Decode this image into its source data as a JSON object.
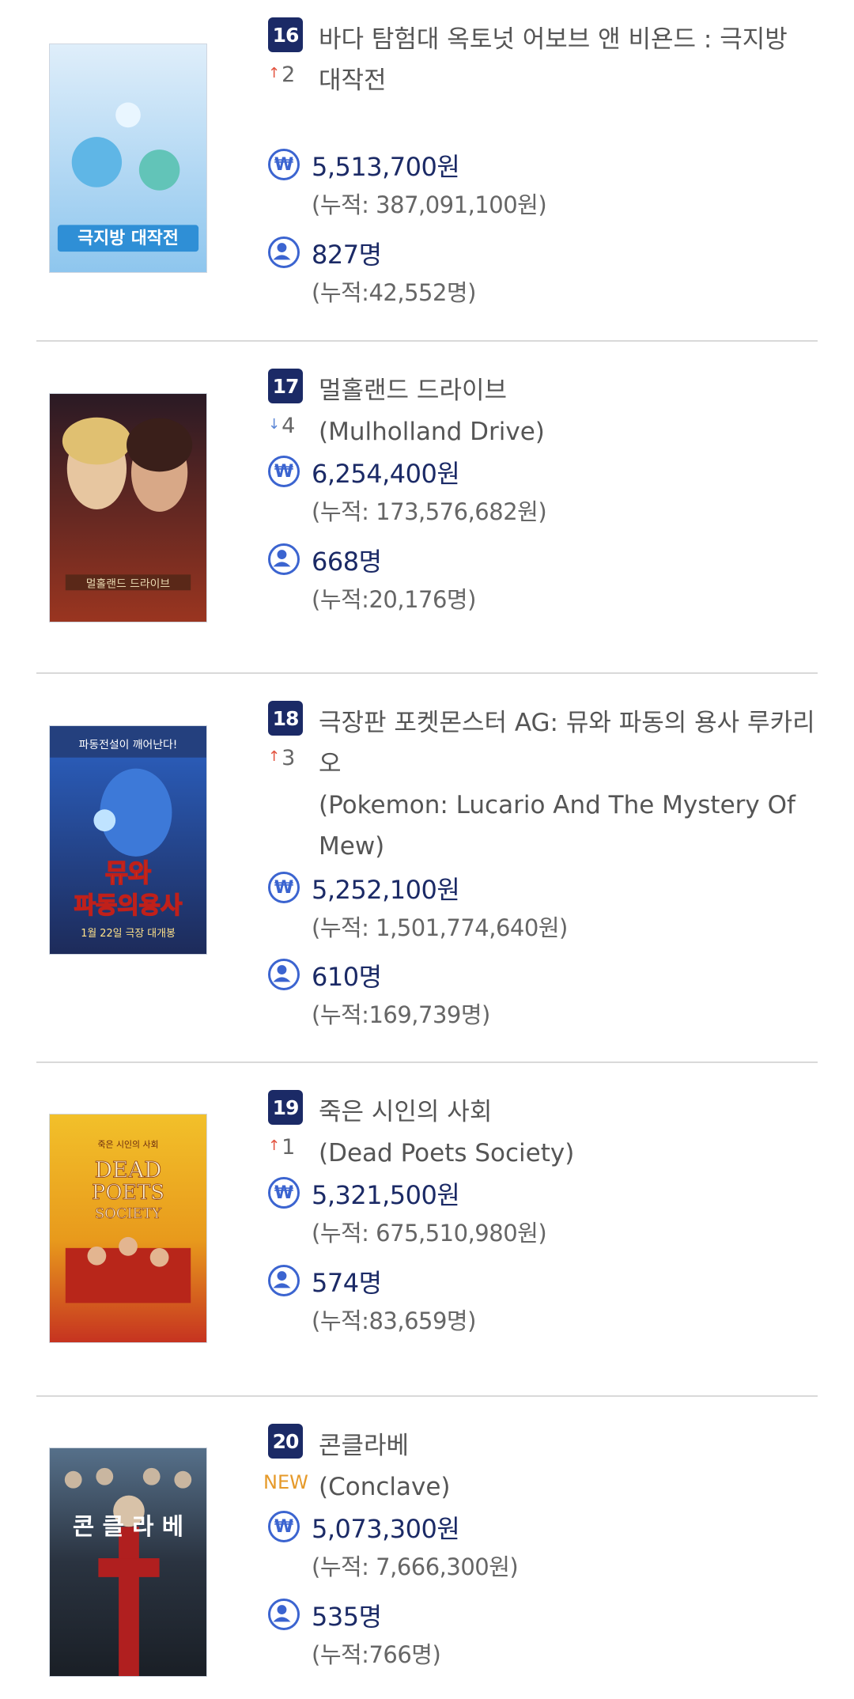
{
  "movies": [
    {
      "rank": "16",
      "change_dir": "up",
      "change_arrow": "↑",
      "change_value": "2",
      "title_ko": "바다 탐험대 옥토넛 어보브 앤 비욘드 : 극지방 대작전",
      "title_en": "",
      "revenue": "5,513,700원",
      "revenue_total": "(누적: 387,091,100원)",
      "audience": "827명",
      "audience_total": "(누적:42,552명)",
      "poster_text": "극지방 대작전",
      "poster_colors": [
        "#dfeefa",
        "#8ec6ee"
      ]
    },
    {
      "rank": "17",
      "change_dir": "down",
      "change_arrow": "↓",
      "change_value": "4",
      "title_ko": "멀홀랜드 드라이브",
      "title_en": "(Mulholland Drive)",
      "revenue": "6,254,400원",
      "revenue_total": "(누적: 173,576,682원)",
      "audience": "668명",
      "audience_total": "(누적:20,176명)",
      "poster_text": "멀홀랜드 드라이브",
      "poster_colors": [
        "#2a1a24",
        "#9a3520"
      ]
    },
    {
      "rank": "18",
      "change_dir": "up",
      "change_arrow": "↑",
      "change_value": "3",
      "title_ko": "극장판 포켓몬스터 AG: 뮤와 파동의 용사 루카리오",
      "title_en": "(Pokemon: Lucario And The Mystery Of Mew)",
      "revenue": "5,252,100원",
      "revenue_total": "(누적: 1,501,774,640원)",
      "audience": "610명",
      "audience_total": "(누적:169,739명)",
      "poster_text": "뮤와 파동의 용사",
      "poster_colors": [
        "#2c62c4",
        "#1d2b5a"
      ]
    },
    {
      "rank": "19",
      "change_dir": "up",
      "change_arrow": "↑",
      "change_value": "1",
      "title_ko": "죽은 시인의 사회",
      "title_en": "(Dead Poets Society)",
      "revenue": "5,321,500원",
      "revenue_total": "(누적: 675,510,980원)",
      "audience": "574명",
      "audience_total": "(누적:83,659명)",
      "poster_text": "DEAD POETS SOCIETY",
      "poster_colors": [
        "#f0b21c",
        "#c63320"
      ]
    },
    {
      "rank": "20",
      "change_dir": "new",
      "change_arrow": "",
      "change_value": "NEW",
      "title_ko": "콘클라베",
      "title_en": "(Conclave)",
      "revenue": "5,073,300원",
      "revenue_total": "(누적: 7,666,300원)",
      "audience": "535명",
      "audience_total": "(누적:766명)",
      "poster_text": "콘 클 라 베",
      "poster_colors": [
        "#2a3340",
        "#b01f1f"
      ]
    }
  ],
  "icons": {
    "won_symbol": "₩"
  }
}
